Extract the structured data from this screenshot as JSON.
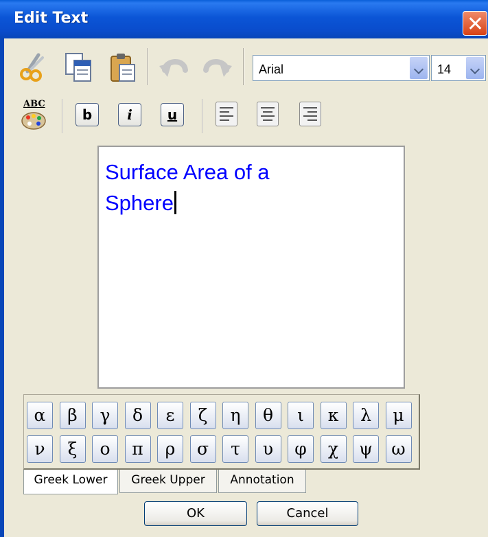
{
  "window": {
    "title": "Edit Text"
  },
  "toolbar": {
    "font_value": "Arial",
    "size_value": "14"
  },
  "formatting": {
    "spell_label": "ABC",
    "bold_label": "b",
    "italic_label": "i",
    "underline_label": "u"
  },
  "editor": {
    "line1": "Surface Area of a",
    "line2": "Sphere",
    "text_color": "#0000ff"
  },
  "symbols": {
    "row1": [
      "α",
      "β",
      "γ",
      "δ",
      "ε",
      "ζ",
      "η",
      "θ",
      "ι",
      "κ",
      "λ",
      "μ"
    ],
    "row2": [
      "ν",
      "ξ",
      "ο",
      "π",
      "ρ",
      "σ",
      "τ",
      "υ",
      "φ",
      "χ",
      "ψ",
      "ω"
    ]
  },
  "tabs": [
    "Greek Lower",
    "Greek Upper",
    "Annotation"
  ],
  "buttons": {
    "ok": "OK",
    "cancel": "Cancel"
  }
}
